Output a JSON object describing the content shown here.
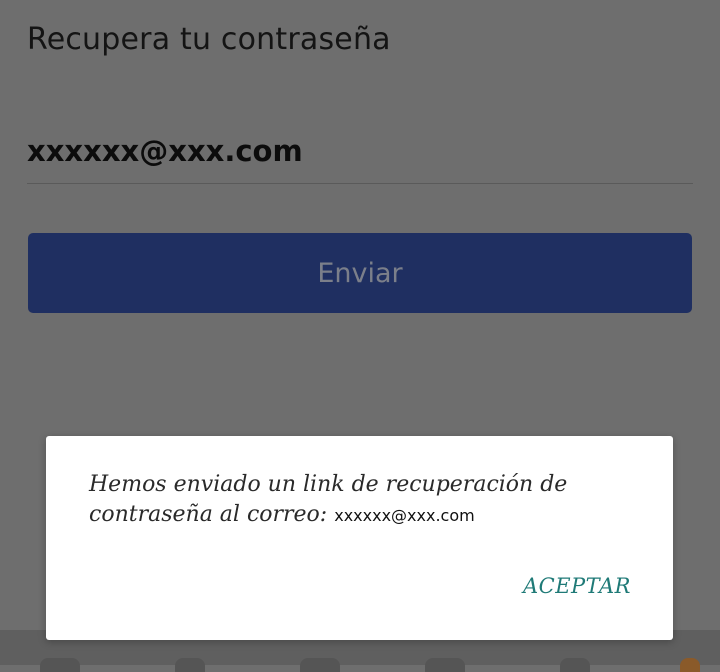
{
  "screen": {
    "title": "Recupera tu contraseña",
    "email_value": "xxxxxx@xxx.com",
    "send_label": "Enviar"
  },
  "dialog": {
    "message": "Hemos enviado un link de recuperación de contraseña al correo: ",
    "email": "xxxxxx@xxx.com",
    "accept_label": "ACEPTAR"
  },
  "colors": {
    "primary_button": "#1f2f61",
    "accent_text": "#1f7a77",
    "scrim_background": "#6e6e6e"
  }
}
